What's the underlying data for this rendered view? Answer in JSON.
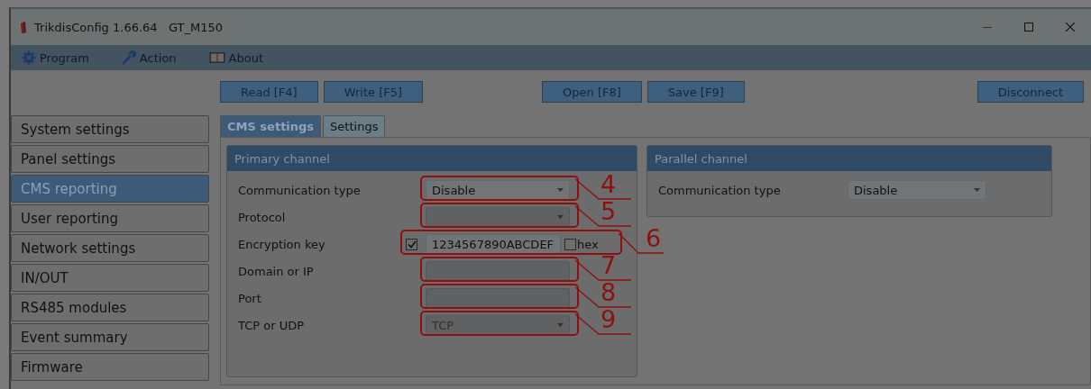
{
  "window": {
    "title": "TrikdisConfig 1.66.64   GT_M150"
  },
  "menu": [
    {
      "label": "Program"
    },
    {
      "label": "Action"
    },
    {
      "label": "About"
    }
  ],
  "toolbar": {
    "left": [
      "Read [F4]",
      "Write [F5]"
    ],
    "middle": [
      "Open [F8]",
      "Save [F9]"
    ],
    "right": [
      "Disconnect"
    ]
  },
  "sidebar": {
    "items": [
      {
        "label": "System settings",
        "selected": false
      },
      {
        "label": "Panel settings",
        "selected": false
      },
      {
        "label": "CMS reporting",
        "selected": true
      },
      {
        "label": "User reporting",
        "selected": false
      },
      {
        "label": "Network settings",
        "selected": false
      },
      {
        "label": "IN/OUT",
        "selected": false
      },
      {
        "label": "RS485 modules",
        "selected": false
      },
      {
        "label": "Event summary",
        "selected": false
      },
      {
        "label": "Firmware",
        "selected": false
      }
    ]
  },
  "tabs": [
    {
      "label": "CMS settings",
      "selected": true
    },
    {
      "label": "Settings",
      "selected": false
    }
  ],
  "primary_channel": {
    "title": "Primary channel",
    "rows": [
      {
        "kind": "select",
        "label": "Communication type",
        "value": "Disable",
        "disabled": false,
        "callout": "4"
      },
      {
        "kind": "select",
        "label": "Protocol",
        "disabled": true,
        "callout": "5"
      },
      {
        "kind": "key",
        "label": "Encryption key",
        "value": "1234567890ABCDEF",
        "checked": true,
        "hex_label": "hex",
        "hex_checked": false,
        "disabled": false,
        "callout": "6"
      },
      {
        "kind": "text",
        "label": "Domain or IP",
        "disabled": true,
        "callout": "7"
      },
      {
        "kind": "text",
        "label": "Port",
        "disabled": true,
        "callout": "8"
      },
      {
        "kind": "select",
        "label": "TCP or UDP",
        "value": "TCP",
        "disabled": true,
        "callout": "9"
      }
    ]
  },
  "parallel_channel": {
    "title": "Parallel channel",
    "rows": [
      {
        "kind": "select",
        "label": "Communication type",
        "value": "Disable",
        "disabled": false
      }
    ]
  }
}
